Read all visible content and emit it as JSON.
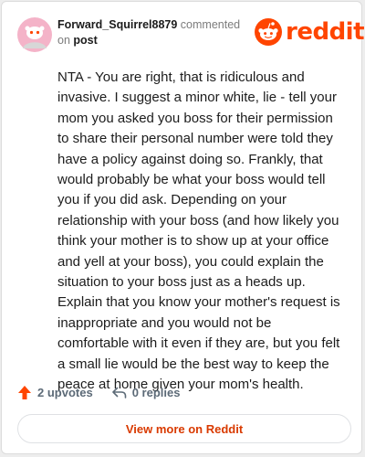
{
  "comment": {
    "username": "Forward_Squirrel8879",
    "action_text": "commented",
    "on_text": "on",
    "post_link": "post",
    "body": "NTA - You are right, that is ridiculous and invasive. I suggest a minor white, lie - tell your mom you asked you boss for their permission to share their personal number were told they have a policy against doing so. Frankly, that would probably be what your boss would tell you if you did ask. Depending on your relationship with your boss (and how likely you think your mother is to show up at your office and yell at your boss), you could explain the situation to your boss just as a heads up. Explain that you know your mother's request is inappropriate and you would not be comfortable with it even if they are, but you felt a small lie would be the best way to keep the peace at home given your mom's health."
  },
  "brand": {
    "name": "reddit",
    "color": "#ff4500"
  },
  "stats": {
    "upvotes": "2 upvotes",
    "replies": "0 replies"
  },
  "cta": {
    "label": "View more on Reddit"
  },
  "icons": {
    "avatar": "snoo-avatar-icon",
    "upvote": "upvote-arrow-icon",
    "reply": "reply-arrow-icon",
    "logo": "reddit-snoo-icon"
  }
}
